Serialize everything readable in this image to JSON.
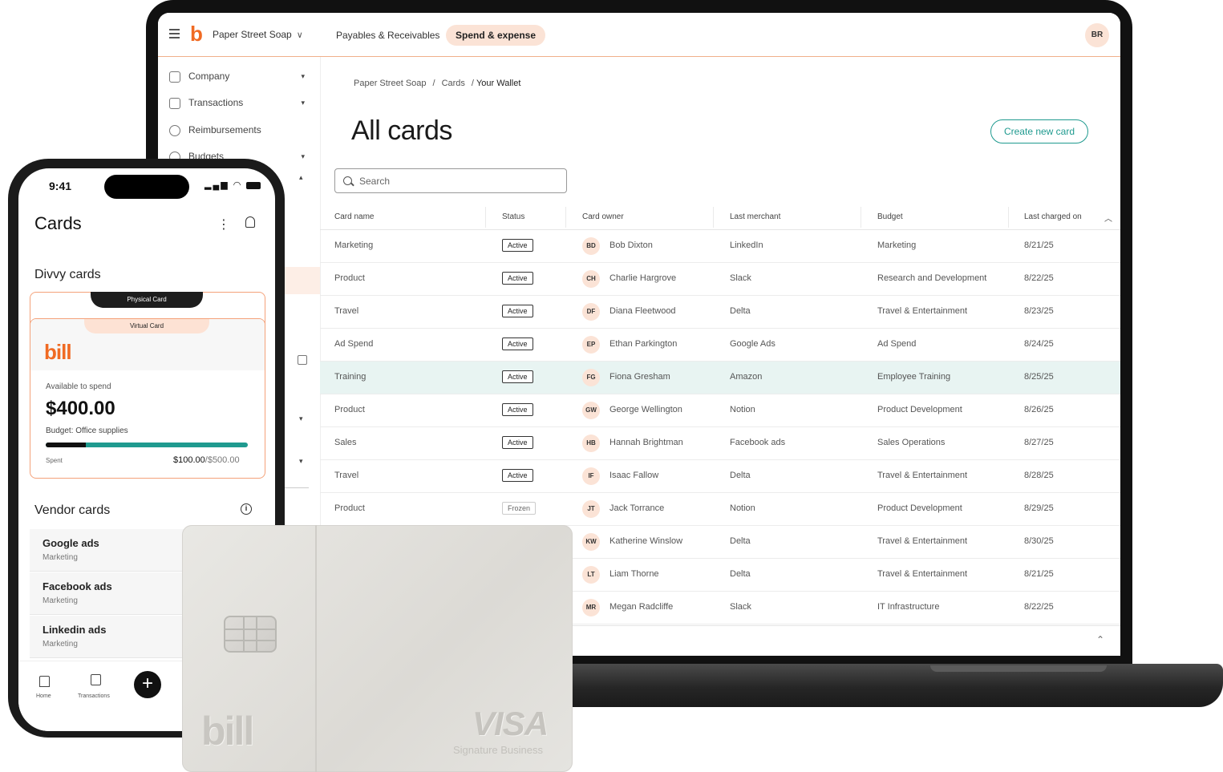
{
  "app": {
    "logo_letter": "b",
    "org_name": "Paper Street Soap",
    "nav_tabs": [
      "Payables & Receivables",
      "Spend & expense"
    ],
    "user_initials": "BR"
  },
  "sidebar": {
    "items": [
      {
        "label": "Company",
        "icon": "building-icon",
        "caret": "▾"
      },
      {
        "label": "Transactions",
        "icon": "receipt-icon",
        "caret": "▾"
      },
      {
        "label": "Reimbursements",
        "icon": "reimburse-icon",
        "caret": ""
      },
      {
        "label": "Budgets",
        "icon": "budget-icon",
        "caret": "▾"
      }
    ],
    "extra_carets": [
      "▴",
      "▾",
      "▾"
    ]
  },
  "breadcrumb": [
    "Paper Street Soap",
    "/",
    "Cards",
    "/",
    "Your Wallet"
  ],
  "page": {
    "title": "All cards",
    "create_button": "Create new card",
    "search_placeholder": "Search"
  },
  "table": {
    "columns": [
      "Card name",
      "Status",
      "Card owner",
      "Last merchant",
      "Budget",
      "Last charged on"
    ],
    "rows": [
      {
        "card": "Marketing",
        "status": "Active",
        "initials": "BD",
        "owner": "Bob Dixton",
        "merchant": "LinkedIn",
        "budget": "Marketing",
        "date": "8/21/25"
      },
      {
        "card": "Product",
        "status": "Active",
        "initials": "CH",
        "owner": "Charlie Hargrove",
        "merchant": "Slack",
        "budget": "Research and Development",
        "date": "8/22/25"
      },
      {
        "card": "Travel",
        "status": "Active",
        "initials": "DF",
        "owner": "Diana Fleetwood",
        "merchant": "Delta",
        "budget": "Travel & Entertainment",
        "date": "8/23/25"
      },
      {
        "card": "Ad Spend",
        "status": "Active",
        "initials": "EP",
        "owner": "Ethan Parkington",
        "merchant": "Google Ads",
        "budget": "Ad Spend",
        "date": "8/24/25"
      },
      {
        "card": "Training",
        "status": "Active",
        "initials": "FG",
        "owner": "Fiona Gresham",
        "merchant": "Amazon",
        "budget": "Employee Training",
        "date": "8/25/25"
      },
      {
        "card": "Product",
        "status": "Active",
        "initials": "GW",
        "owner": "George Wellington",
        "merchant": "Notion",
        "budget": "Product Development",
        "date": "8/26/25"
      },
      {
        "card": "Sales",
        "status": "Active",
        "initials": "HB",
        "owner": "Hannah Brightman",
        "merchant": "Facebook ads",
        "budget": "Sales Operations",
        "date": "8/27/25"
      },
      {
        "card": "Travel",
        "status": "Active",
        "initials": "IF",
        "owner": "Isaac Fallow",
        "merchant": "Delta",
        "budget": "Travel & Entertainment",
        "date": "8/28/25"
      },
      {
        "card": "Product",
        "status": "Frozen",
        "initials": "JT",
        "owner": "Jack Torrance",
        "merchant": "Notion",
        "budget": "Product Development",
        "date": "8/29/25"
      },
      {
        "card": "",
        "status": "",
        "initials": "KW",
        "owner": "Katherine Winslow",
        "merchant": "Delta",
        "budget": "Travel & Entertainment",
        "date": "8/30/25"
      },
      {
        "card": "",
        "status": "",
        "initials": "LT",
        "owner": "Liam Thorne",
        "merchant": "Delta",
        "budget": "Travel & Entertainment",
        "date": "8/21/25"
      },
      {
        "card": "",
        "status": "",
        "initials": "MR",
        "owner": "Megan Radcliffe",
        "merchant": "Slack",
        "budget": "IT Infrastructure",
        "date": "8/22/25"
      }
    ],
    "highlighted_row": 4
  },
  "phone": {
    "time": "9:41",
    "title": "Cards",
    "divvy_section": "Divvy cards",
    "physical_tab": "Physical Card",
    "virtual_tab": "Virtual Card",
    "card_brand": "bill",
    "available_label": "Available to spend",
    "available_amount": "$400.00",
    "budget_label": "Budget: Office supplies",
    "spent_label": "Spent",
    "spent_value": "$100.00",
    "spent_total": "/$500.00",
    "spent_fraction": 0.2,
    "vendor_section": "Vendor cards",
    "vendors": [
      {
        "name": "Google ads",
        "budget": "Marketing"
      },
      {
        "name": "Facebook ads",
        "budget": "Marketing"
      },
      {
        "name": "Linkedin ads",
        "budget": "Marketing"
      }
    ],
    "tabs": [
      "Home",
      "Transactions"
    ],
    "fab": "+"
  },
  "physical_card": {
    "brand": "bill",
    "network": "VISA",
    "network_sub": "Signature Business"
  },
  "colors": {
    "accent": "#f06a23",
    "teal": "#1f9a8f",
    "peach": "#fbe3d6"
  }
}
